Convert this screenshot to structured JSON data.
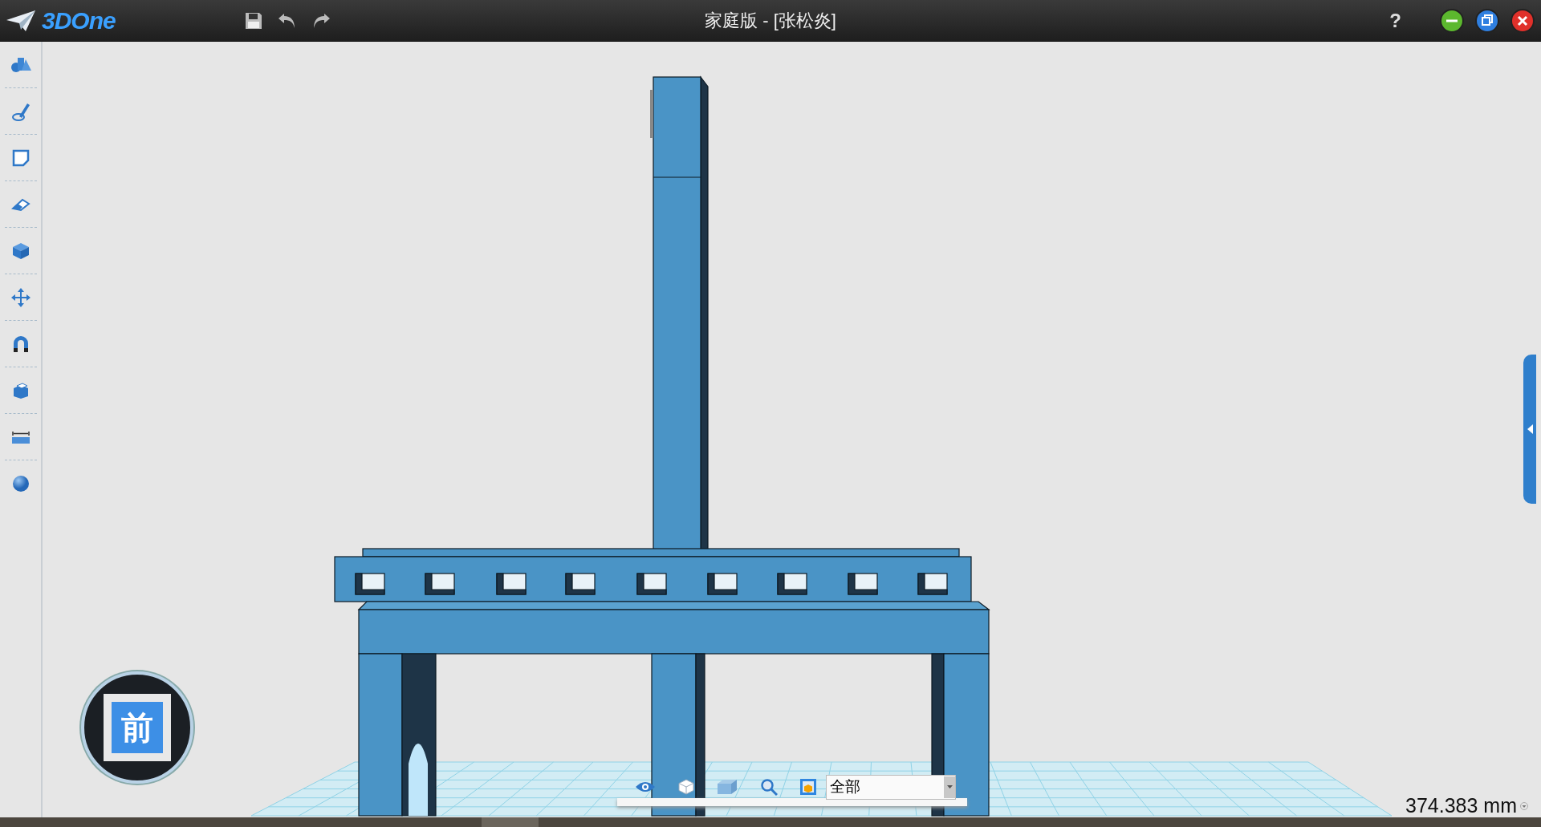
{
  "title_bar": {
    "logo": "3DOne",
    "title": "家庭版 - [张松炎]",
    "help": "?"
  },
  "view_cube": {
    "label": "前"
  },
  "view_toolbar": {
    "filter": "全部"
  },
  "status": {
    "measurement": "374.383 mm"
  }
}
